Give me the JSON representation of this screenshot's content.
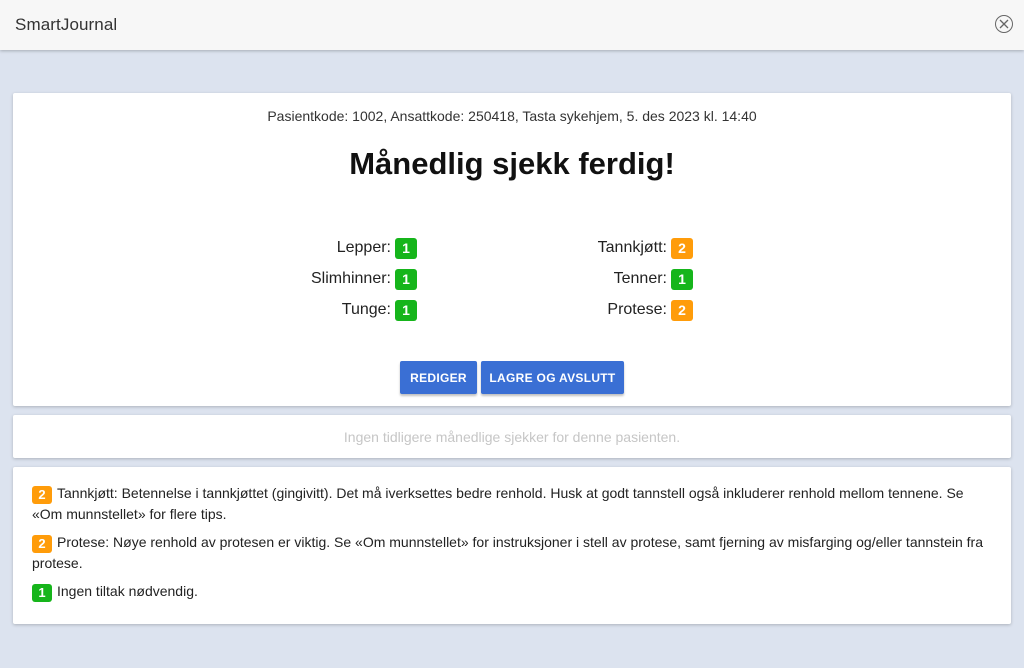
{
  "app": {
    "title": "SmartJournal"
  },
  "header": {
    "meta": "Pasientkode: 1002, Ansattkode: 250418, Tasta sykehjem, 5. des 2023 kl. 14:40",
    "title": "Månedlig sjekk ferdig!"
  },
  "scores": {
    "left": [
      {
        "label": "Lepper:",
        "value": "1",
        "color": "green"
      },
      {
        "label": "Slimhinner:",
        "value": "1",
        "color": "green"
      },
      {
        "label": "Tunge:",
        "value": "1",
        "color": "green"
      }
    ],
    "right": [
      {
        "label": "Tannkjøtt:",
        "value": "2",
        "color": "orange"
      },
      {
        "label": "Tenner:",
        "value": "1",
        "color": "green"
      },
      {
        "label": "Protese:",
        "value": "2",
        "color": "orange"
      }
    ]
  },
  "buttons": {
    "edit": "REDIGER",
    "save": "LAGRE OG AVSLUTT"
  },
  "history": {
    "empty_text": "Ingen tidligere månedlige sjekker for denne pasienten."
  },
  "legend": [
    {
      "badge": "2",
      "color": "orange",
      "text": "Tannkjøtt: Betennelse i tannkjøttet (gingivitt). Det må iverksettes bedre renhold. Husk at godt tannstell også inkluderer renhold mellom tennene. Se «Om munnstellet» for flere tips."
    },
    {
      "badge": "2",
      "color": "orange",
      "text": "Protese: Nøye renhold av protesen er viktig. Se «Om munnstellet» for instruksjoner i stell av protese, samt fjerning av misfarging og/eller tannstein fra protese."
    },
    {
      "badge": "1",
      "color": "green",
      "text": "Ingen tiltak nødvendig."
    }
  ],
  "colors": {
    "green": "#16b51b",
    "orange": "#ff9c0a",
    "button": "#3a6fd4",
    "background": "#dce3ef"
  }
}
